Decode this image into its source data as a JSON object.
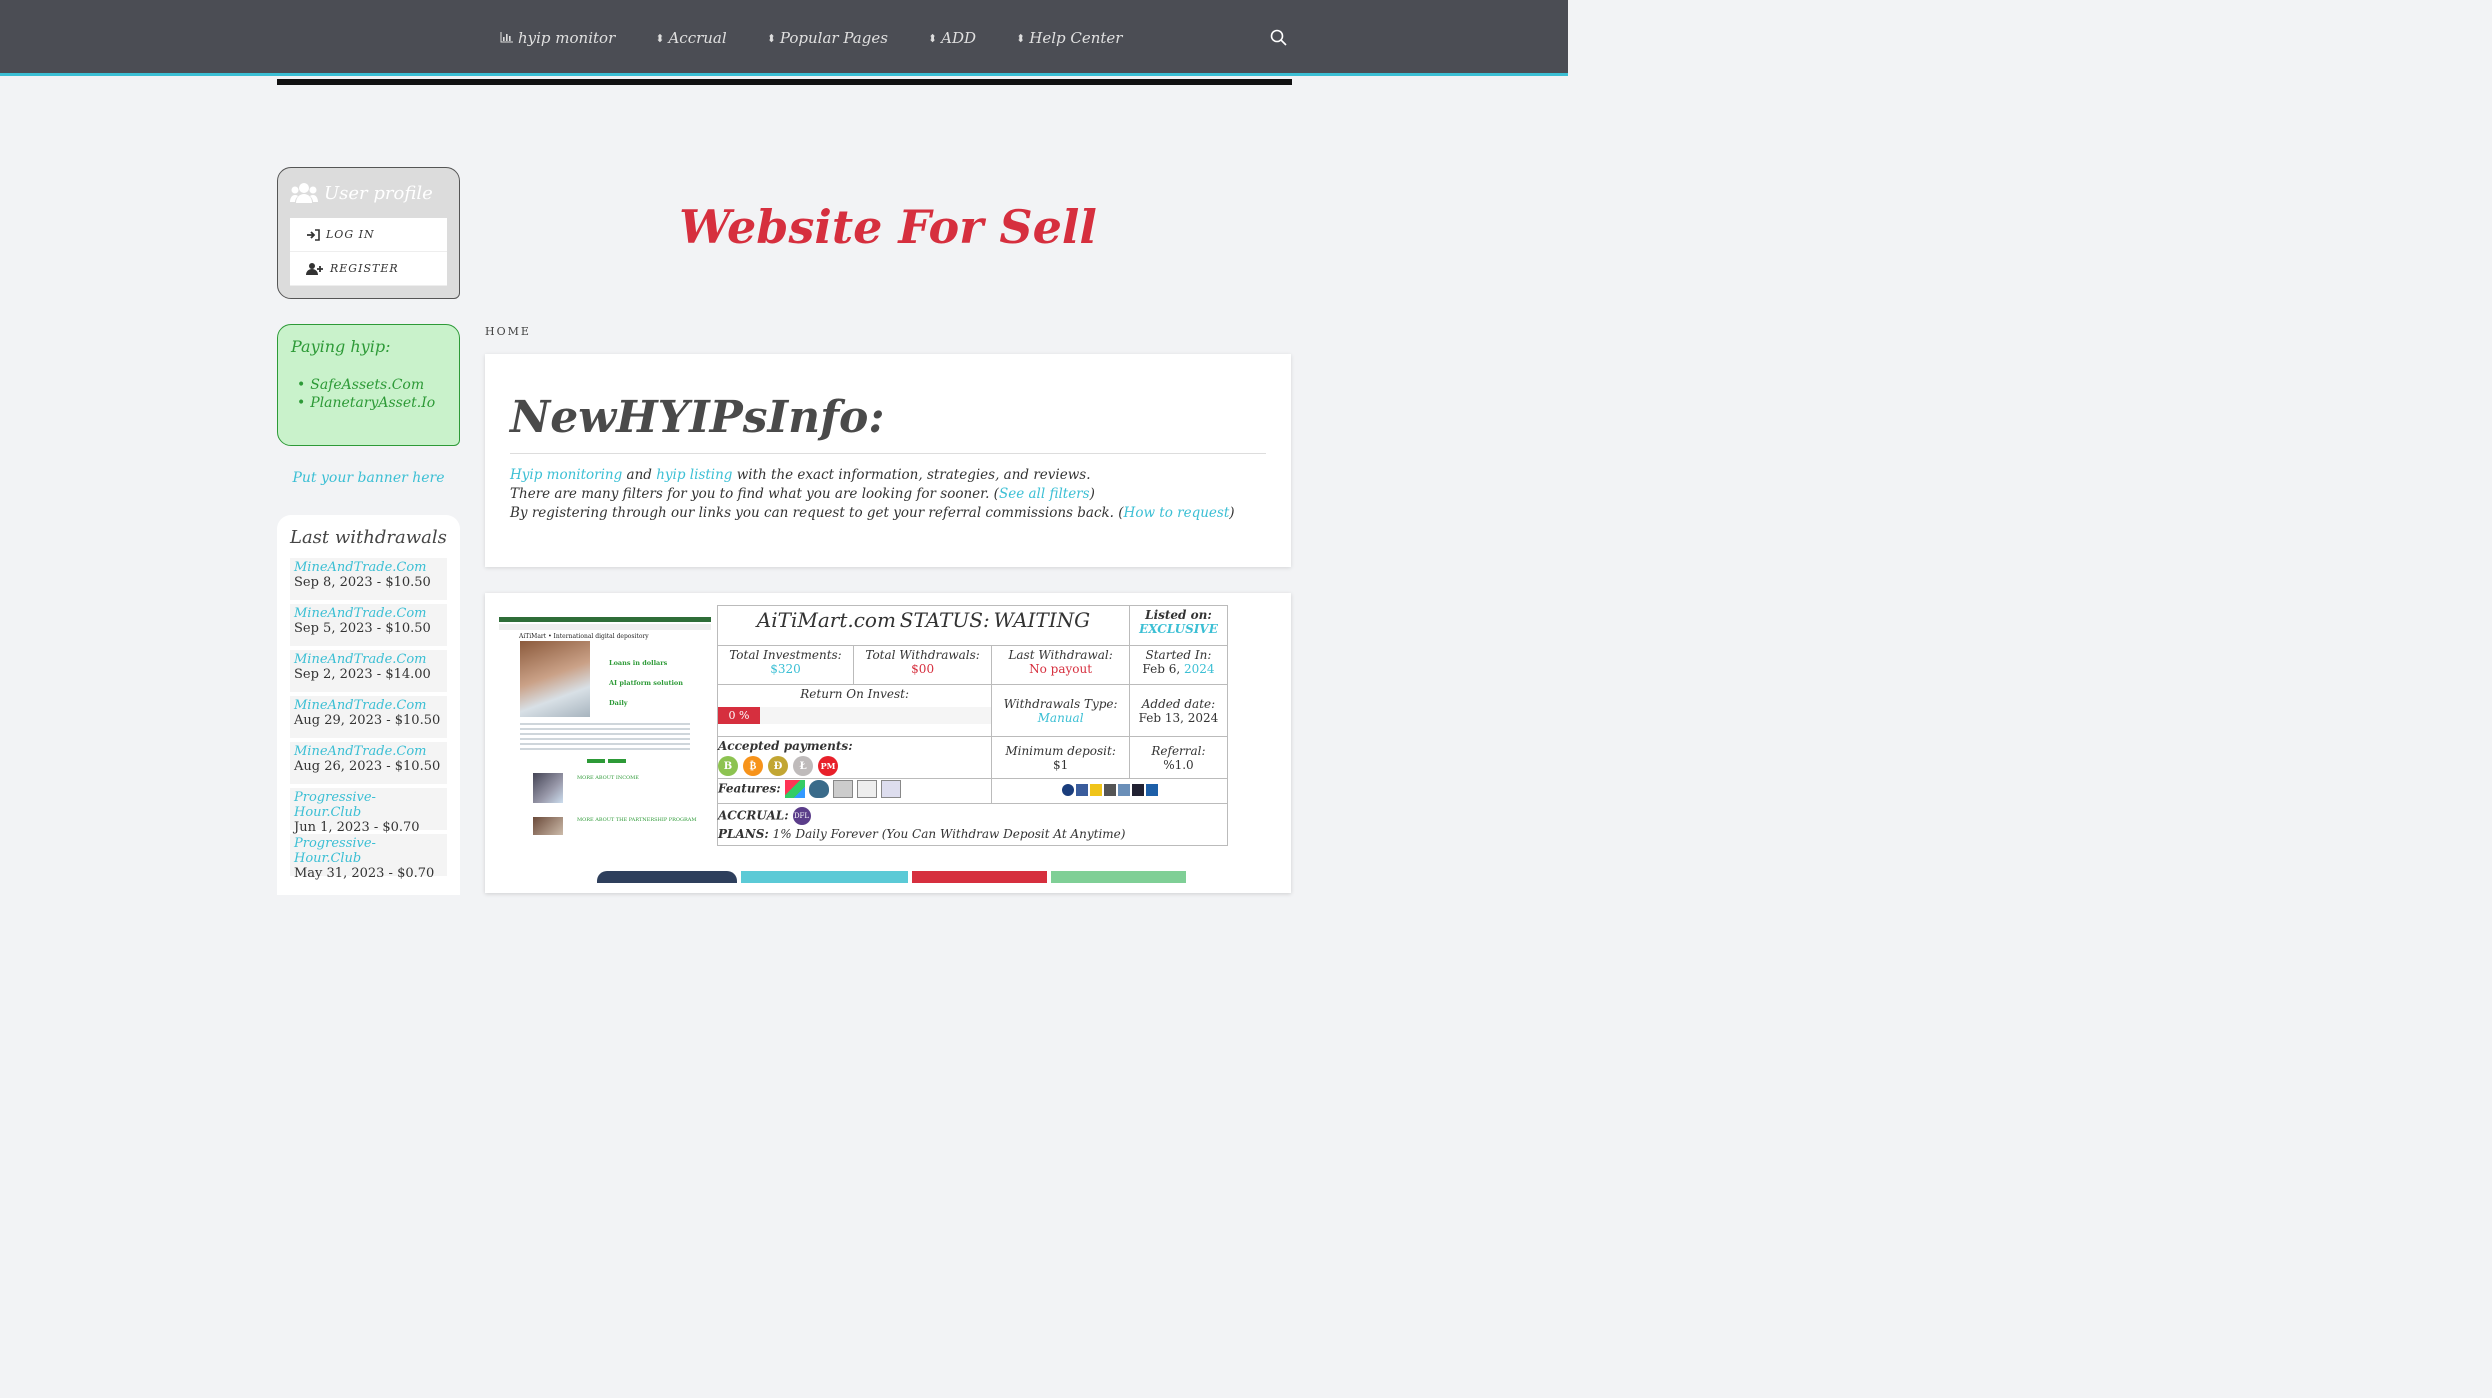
{
  "nav": {
    "items": [
      {
        "icon": "bar-chart-icon",
        "label": "hyip monitor"
      },
      {
        "icon": "sort-icon",
        "label": "Accrual"
      },
      {
        "icon": "sort-icon",
        "label": "Popular Pages"
      },
      {
        "icon": "sort-icon",
        "label": "ADD"
      },
      {
        "icon": "sort-icon",
        "label": "Help Center"
      }
    ]
  },
  "sidebar": {
    "profile": {
      "title": "User profile",
      "login": "LOG IN",
      "register": "REGISTER"
    },
    "paying": {
      "title": "Paying hyip:",
      "items": [
        "SafeAssets.Com",
        "PlanetaryAsset.Io"
      ]
    },
    "banner": "Put your banner here",
    "withdrawals": {
      "title": "Last withdrawals",
      "items": [
        {
          "site": "MineAndTrade.Com",
          "meta": "Sep 8, 2023 - $10.50"
        },
        {
          "site": "MineAndTrade.Com",
          "meta": "Sep 5, 2023 - $10.50"
        },
        {
          "site": "MineAndTrade.Com",
          "meta": "Sep 2, 2023 - $14.00"
        },
        {
          "site": "MineAndTrade.Com",
          "meta": "Aug 29, 2023 - $10.50"
        },
        {
          "site": "MineAndTrade.Com",
          "meta": "Aug 26, 2023 - $10.50"
        },
        {
          "site": "Progressive-Hour.Club",
          "meta": "Jun 1, 2023 - $0.70"
        },
        {
          "site": "Progressive-Hour.Club",
          "meta": "May 31, 2023 - $0.70"
        }
      ]
    }
  },
  "main": {
    "hero": "Website For Sell",
    "breadcrumb": "HOME",
    "info": {
      "title": "NewHYIPsInfo:",
      "line1_link1": "Hyip monitoring",
      "line1_and": " and ",
      "line1_link2": "hyip listing",
      "line1_rest": " with the exact information, strategies, and reviews.",
      "line2_text": "There are many filters for you to find what you are looking for sooner. (",
      "line2_link": "See all filters",
      "line2_close": ")",
      "line3_text": "By registering through our links you can request to get your referral commissions back. (",
      "line3_link": "How to request",
      "line3_close": ")"
    },
    "listing": {
      "screenshot": {
        "brand": "AiTiMart • International digital depository",
        "lines": [
          "Loans in dollars",
          "AI platform solution",
          "Daily"
        ],
        "heading1": "MORE ABOUT INCOME",
        "heading2": "MORE ABOUT THE PARTNERSHIP PROGRAM"
      },
      "site": "AiTiMart.com",
      "status_label": "STATUS:",
      "status": "WAITING",
      "listed_on_label": "Listed on:",
      "listed_on": "EXCLUSIVE",
      "total_investments_label": "Total Investments:",
      "total_investments": "$320",
      "total_withdrawals_label": "Total Withdrawals:",
      "total_withdrawals": "$00",
      "last_withdrawal_label": "Last Withdrawal:",
      "last_withdrawal": "No payout",
      "started_label": "Started In:",
      "started_prefix": "Feb 6, ",
      "started_year": "2024",
      "roi_label": "Return On Invest:",
      "roi": "0 %",
      "withdrawals_type_label": "Withdrawals Type:",
      "withdrawals_type": "Manual",
      "added_label": "Added date:",
      "added": "Feb 13, 2024",
      "accepted_label": "Accepted payments:",
      "coins": [
        {
          "symbol": "B",
          "name": "bitcoin-cash-icon",
          "color": "#8dc351"
        },
        {
          "symbol": "₿",
          "name": "bitcoin-icon",
          "color": "#f7931a"
        },
        {
          "symbol": "Ð",
          "name": "dogecoin-icon",
          "color": "#c2a633"
        },
        {
          "symbol": "Ł",
          "name": "litecoin-icon",
          "color": "#bfbbbb"
        },
        {
          "symbol": "PM",
          "name": "perfect-money-icon",
          "color": "#e8202a"
        }
      ],
      "min_deposit_label": "Minimum deposit:",
      "min_deposit": "$1",
      "referral_label": "Referral:",
      "referral": "%1.0",
      "features_label": "Features:",
      "accrual_label": "ACCRUAL:",
      "accrual_badge": "DFL",
      "plans_label": "PLANS:",
      "plans": "1% Daily Forever (You Can Withdraw Deposit At Anytime)"
    }
  },
  "colors": {
    "accent": "#3bbfd4",
    "hero_red": "#d62f3e",
    "topbar": "#4b4d54",
    "paying_green": "#2d9a37",
    "button_navy": "#2e3f5c",
    "button_teal": "#5bcad6",
    "button_red": "#d62f3e",
    "button_green": "#7fcf96"
  }
}
